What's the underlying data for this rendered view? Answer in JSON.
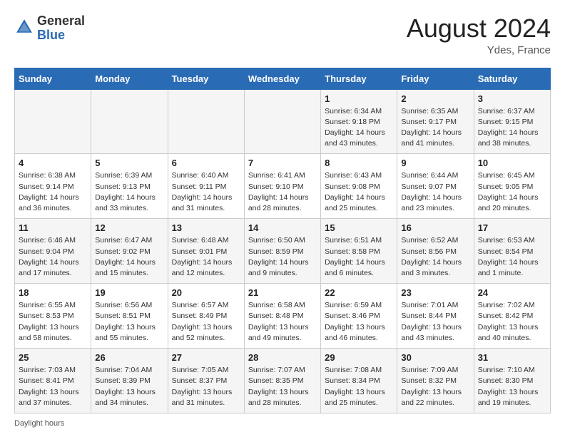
{
  "header": {
    "logo_general": "General",
    "logo_blue": "Blue",
    "month_year": "August 2024",
    "location": "Ydes, France"
  },
  "days_of_week": [
    "Sunday",
    "Monday",
    "Tuesday",
    "Wednesday",
    "Thursday",
    "Friday",
    "Saturday"
  ],
  "footer": {
    "note": "Daylight hours"
  },
  "weeks": [
    {
      "days": [
        {
          "date": "",
          "info": ""
        },
        {
          "date": "",
          "info": ""
        },
        {
          "date": "",
          "info": ""
        },
        {
          "date": "",
          "info": ""
        },
        {
          "date": "1",
          "info": "Sunrise: 6:34 AM\nSunset: 9:18 PM\nDaylight: 14 hours\nand 43 minutes."
        },
        {
          "date": "2",
          "info": "Sunrise: 6:35 AM\nSunset: 9:17 PM\nDaylight: 14 hours\nand 41 minutes."
        },
        {
          "date": "3",
          "info": "Sunrise: 6:37 AM\nSunset: 9:15 PM\nDaylight: 14 hours\nand 38 minutes."
        }
      ]
    },
    {
      "days": [
        {
          "date": "4",
          "info": "Sunrise: 6:38 AM\nSunset: 9:14 PM\nDaylight: 14 hours\nand 36 minutes."
        },
        {
          "date": "5",
          "info": "Sunrise: 6:39 AM\nSunset: 9:13 PM\nDaylight: 14 hours\nand 33 minutes."
        },
        {
          "date": "6",
          "info": "Sunrise: 6:40 AM\nSunset: 9:11 PM\nDaylight: 14 hours\nand 31 minutes."
        },
        {
          "date": "7",
          "info": "Sunrise: 6:41 AM\nSunset: 9:10 PM\nDaylight: 14 hours\nand 28 minutes."
        },
        {
          "date": "8",
          "info": "Sunrise: 6:43 AM\nSunset: 9:08 PM\nDaylight: 14 hours\nand 25 minutes."
        },
        {
          "date": "9",
          "info": "Sunrise: 6:44 AM\nSunset: 9:07 PM\nDaylight: 14 hours\nand 23 minutes."
        },
        {
          "date": "10",
          "info": "Sunrise: 6:45 AM\nSunset: 9:05 PM\nDaylight: 14 hours\nand 20 minutes."
        }
      ]
    },
    {
      "days": [
        {
          "date": "11",
          "info": "Sunrise: 6:46 AM\nSunset: 9:04 PM\nDaylight: 14 hours\nand 17 minutes."
        },
        {
          "date": "12",
          "info": "Sunrise: 6:47 AM\nSunset: 9:02 PM\nDaylight: 14 hours\nand 15 minutes."
        },
        {
          "date": "13",
          "info": "Sunrise: 6:48 AM\nSunset: 9:01 PM\nDaylight: 14 hours\nand 12 minutes."
        },
        {
          "date": "14",
          "info": "Sunrise: 6:50 AM\nSunset: 8:59 PM\nDaylight: 14 hours\nand 9 minutes."
        },
        {
          "date": "15",
          "info": "Sunrise: 6:51 AM\nSunset: 8:58 PM\nDaylight: 14 hours\nand 6 minutes."
        },
        {
          "date": "16",
          "info": "Sunrise: 6:52 AM\nSunset: 8:56 PM\nDaylight: 14 hours\nand 3 minutes."
        },
        {
          "date": "17",
          "info": "Sunrise: 6:53 AM\nSunset: 8:54 PM\nDaylight: 14 hours\nand 1 minute."
        }
      ]
    },
    {
      "days": [
        {
          "date": "18",
          "info": "Sunrise: 6:55 AM\nSunset: 8:53 PM\nDaylight: 13 hours\nand 58 minutes."
        },
        {
          "date": "19",
          "info": "Sunrise: 6:56 AM\nSunset: 8:51 PM\nDaylight: 13 hours\nand 55 minutes."
        },
        {
          "date": "20",
          "info": "Sunrise: 6:57 AM\nSunset: 8:49 PM\nDaylight: 13 hours\nand 52 minutes."
        },
        {
          "date": "21",
          "info": "Sunrise: 6:58 AM\nSunset: 8:48 PM\nDaylight: 13 hours\nand 49 minutes."
        },
        {
          "date": "22",
          "info": "Sunrise: 6:59 AM\nSunset: 8:46 PM\nDaylight: 13 hours\nand 46 minutes."
        },
        {
          "date": "23",
          "info": "Sunrise: 7:01 AM\nSunset: 8:44 PM\nDaylight: 13 hours\nand 43 minutes."
        },
        {
          "date": "24",
          "info": "Sunrise: 7:02 AM\nSunset: 8:42 PM\nDaylight: 13 hours\nand 40 minutes."
        }
      ]
    },
    {
      "days": [
        {
          "date": "25",
          "info": "Sunrise: 7:03 AM\nSunset: 8:41 PM\nDaylight: 13 hours\nand 37 minutes."
        },
        {
          "date": "26",
          "info": "Sunrise: 7:04 AM\nSunset: 8:39 PM\nDaylight: 13 hours\nand 34 minutes."
        },
        {
          "date": "27",
          "info": "Sunrise: 7:05 AM\nSunset: 8:37 PM\nDaylight: 13 hours\nand 31 minutes."
        },
        {
          "date": "28",
          "info": "Sunrise: 7:07 AM\nSunset: 8:35 PM\nDaylight: 13 hours\nand 28 minutes."
        },
        {
          "date": "29",
          "info": "Sunrise: 7:08 AM\nSunset: 8:34 PM\nDaylight: 13 hours\nand 25 minutes."
        },
        {
          "date": "30",
          "info": "Sunrise: 7:09 AM\nSunset: 8:32 PM\nDaylight: 13 hours\nand 22 minutes."
        },
        {
          "date": "31",
          "info": "Sunrise: 7:10 AM\nSunset: 8:30 PM\nDaylight: 13 hours\nand 19 minutes."
        }
      ]
    }
  ]
}
